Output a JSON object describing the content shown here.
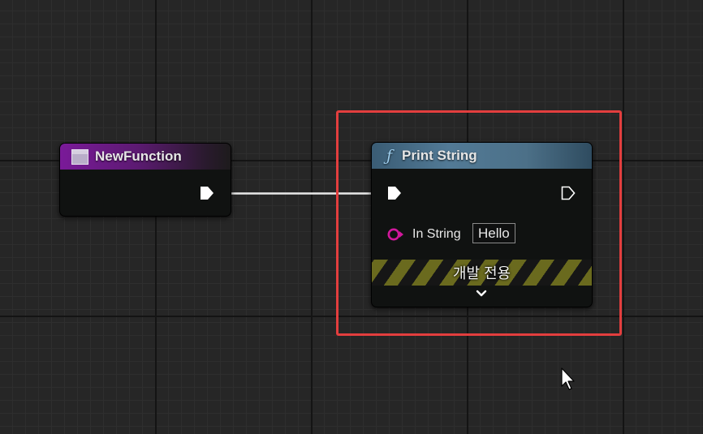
{
  "nodes": {
    "new_function": {
      "title": "NewFunction"
    },
    "print_string": {
      "title": "Print String",
      "function_glyph": "ƒ",
      "in_string_label": "In String",
      "in_string_value": "Hello",
      "dev_only_label": "개발 전용"
    }
  },
  "icons": {
    "function_entry": "function-entry-icon",
    "function": "function-icon",
    "exec_pin": "exec-pin-icon",
    "string_pin": "string-pin-icon",
    "expand": "chevron-down-icon",
    "cursor": "mouse-cursor-icon"
  },
  "colors": {
    "graph_background": "#262626",
    "new_function_header": "#7a1a99",
    "print_string_header": "#527a96",
    "string_pin": "#d1189c",
    "selection": "#e33e3e",
    "dev_only_stripe": "#6a6a1e"
  }
}
